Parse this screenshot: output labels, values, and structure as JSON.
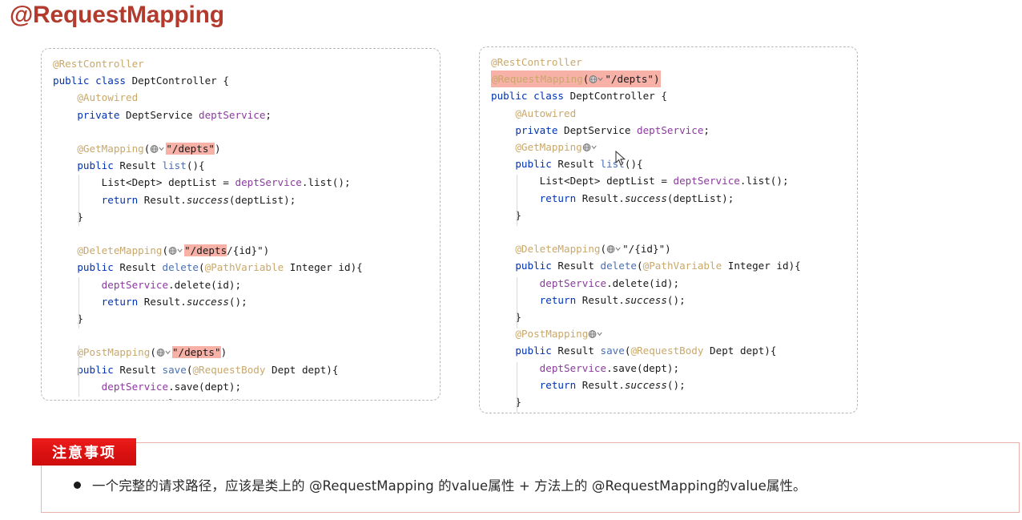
{
  "title": "@RequestMapping",
  "colors": {
    "title": "#b23b2e",
    "highlight": "#f7b1a7",
    "keyword": "#0033b3",
    "annotation": "#c9a86a",
    "field": "#8b3b9e",
    "method": "#4a6fb5",
    "badge_red": "#ee1c1c",
    "notes_border": "#e8b4ad"
  },
  "left_panel": {
    "name": "code-without-class-level-mapping",
    "lines": [
      {
        "indent": 0,
        "tokens": [
          {
            "t": "@RestController",
            "c": "ann"
          }
        ]
      },
      {
        "indent": 0,
        "tokens": [
          {
            "t": "public",
            "c": "kw"
          },
          {
            "t": " "
          },
          {
            "t": "class",
            "c": "kw"
          },
          {
            "t": " DeptController {"
          }
        ]
      },
      {
        "indent": 1,
        "tokens": [
          {
            "t": "@Autowired",
            "c": "ann"
          }
        ]
      },
      {
        "indent": 1,
        "tokens": [
          {
            "t": "private",
            "c": "kw"
          },
          {
            "t": " DeptService "
          },
          {
            "t": "deptService",
            "c": "fld"
          },
          {
            "t": ";"
          }
        ]
      },
      {
        "indent": 1,
        "blank": true
      },
      {
        "indent": 1,
        "tokens": [
          {
            "t": "@GetMapping",
            "c": "ann"
          },
          {
            "t": "("
          },
          {
            "t": "",
            "c": "inlay"
          },
          {
            "t": "\"/depts\"",
            "c": "hl"
          },
          {
            "t": ")"
          }
        ]
      },
      {
        "indent": 1,
        "tokens": [
          {
            "t": "public",
            "c": "kw"
          },
          {
            "t": " Result "
          },
          {
            "t": "list",
            "c": "mth"
          },
          {
            "t": "(){"
          }
        ]
      },
      {
        "indent": 2,
        "tokens": [
          {
            "t": "List<Dept> deptList = "
          },
          {
            "t": "deptService",
            "c": "fld"
          },
          {
            "t": ".list();"
          }
        ]
      },
      {
        "indent": 2,
        "tokens": [
          {
            "t": "return",
            "c": "kw"
          },
          {
            "t": " Result."
          },
          {
            "t": "success",
            "c": "ital"
          },
          {
            "t": "(deptList);"
          }
        ]
      },
      {
        "indent": 1,
        "tokens": [
          {
            "t": "}"
          }
        ]
      },
      {
        "indent": 1,
        "blank": true
      },
      {
        "indent": 1,
        "tokens": [
          {
            "t": "@DeleteMapping",
            "c": "ann"
          },
          {
            "t": "("
          },
          {
            "t": "",
            "c": "inlay"
          },
          {
            "t": "\"/depts",
            "c": "hl"
          },
          {
            "t": "/{id}\""
          },
          {
            "t": ")"
          }
        ]
      },
      {
        "indent": 1,
        "tokens": [
          {
            "t": "public",
            "c": "kw"
          },
          {
            "t": " Result "
          },
          {
            "t": "delete",
            "c": "mth"
          },
          {
            "t": "("
          },
          {
            "t": "@PathVariable",
            "c": "ann"
          },
          {
            "t": " Integer id){"
          }
        ]
      },
      {
        "indent": 2,
        "tokens": [
          {
            "t": "deptService",
            "c": "fld"
          },
          {
            "t": ".delete(id);"
          }
        ]
      },
      {
        "indent": 2,
        "tokens": [
          {
            "t": "return",
            "c": "kw"
          },
          {
            "t": " Result."
          },
          {
            "t": "success",
            "c": "ital"
          },
          {
            "t": "();"
          }
        ]
      },
      {
        "indent": 1,
        "tokens": [
          {
            "t": "}"
          }
        ]
      },
      {
        "indent": 1,
        "blank": true
      },
      {
        "indent": 1,
        "tokens": [
          {
            "t": "@PostMapping",
            "c": "ann"
          },
          {
            "t": "("
          },
          {
            "t": "",
            "c": "inlay"
          },
          {
            "t": "\"/depts\"",
            "c": "hl"
          },
          {
            "t": ")"
          }
        ]
      },
      {
        "indent": 1,
        "tokens": [
          {
            "t": "public",
            "c": "kw"
          },
          {
            "t": " Result "
          },
          {
            "t": "save",
            "c": "mth"
          },
          {
            "t": "("
          },
          {
            "t": "@RequestBody",
            "c": "ann"
          },
          {
            "t": " Dept dept){"
          }
        ]
      },
      {
        "indent": 2,
        "tokens": [
          {
            "t": "deptService",
            "c": "fld"
          },
          {
            "t": ".save(dept);"
          }
        ]
      },
      {
        "indent": 2,
        "tokens": [
          {
            "t": "return",
            "c": "kw"
          },
          {
            "t": " Result."
          },
          {
            "t": "success",
            "c": "ital"
          },
          {
            "t": "();"
          }
        ]
      },
      {
        "indent": 1,
        "tokens": [
          {
            "t": "}"
          }
        ]
      },
      {
        "indent": 1,
        "blank": true
      },
      {
        "indent": 0,
        "tokens": [
          {
            "t": "}"
          }
        ]
      }
    ]
  },
  "right_panel": {
    "name": "code-with-class-level-mapping",
    "lines": [
      {
        "indent": 0,
        "tokens": [
          {
            "t": "@RestController",
            "c": "ann"
          }
        ]
      },
      {
        "indent": 0,
        "hl_line": true,
        "tokens": [
          {
            "t": "@RequestMapping",
            "c": "ann"
          },
          {
            "t": "("
          },
          {
            "t": "",
            "c": "inlay"
          },
          {
            "t": "\"/depts\""
          },
          {
            "t": ")"
          }
        ]
      },
      {
        "indent": 0,
        "tokens": [
          {
            "t": "public",
            "c": "kw"
          },
          {
            "t": " "
          },
          {
            "t": "class",
            "c": "kw"
          },
          {
            "t": " DeptController {"
          }
        ]
      },
      {
        "indent": 1,
        "tokens": [
          {
            "t": "@Autowired",
            "c": "ann"
          }
        ]
      },
      {
        "indent": 1,
        "tokens": [
          {
            "t": "private",
            "c": "kw"
          },
          {
            "t": " DeptService "
          },
          {
            "t": "deptService",
            "c": "fld"
          },
          {
            "t": ";"
          }
        ]
      },
      {
        "indent": 1,
        "tokens": [
          {
            "t": "@GetMapping",
            "c": "ann"
          },
          {
            "t": "",
            "c": "inlay"
          }
        ]
      },
      {
        "indent": 1,
        "tokens": [
          {
            "t": "public",
            "c": "kw"
          },
          {
            "t": " Result "
          },
          {
            "t": "list",
            "c": "mth"
          },
          {
            "t": "(){"
          }
        ]
      },
      {
        "indent": 2,
        "tokens": [
          {
            "t": "List<Dept> deptList = "
          },
          {
            "t": "deptService",
            "c": "fld"
          },
          {
            "t": ".list();"
          }
        ]
      },
      {
        "indent": 2,
        "tokens": [
          {
            "t": "return",
            "c": "kw"
          },
          {
            "t": " Result."
          },
          {
            "t": "success",
            "c": "ital"
          },
          {
            "t": "(deptList);"
          }
        ]
      },
      {
        "indent": 1,
        "tokens": [
          {
            "t": "}"
          }
        ]
      },
      {
        "indent": 1,
        "blank": true
      },
      {
        "indent": 1,
        "tokens": [
          {
            "t": "@DeleteMapping",
            "c": "ann"
          },
          {
            "t": "("
          },
          {
            "t": "",
            "c": "inlay"
          },
          {
            "t": "\"/{id}\""
          },
          {
            "t": ")"
          }
        ]
      },
      {
        "indent": 1,
        "tokens": [
          {
            "t": "public",
            "c": "kw"
          },
          {
            "t": " Result "
          },
          {
            "t": "delete",
            "c": "mth"
          },
          {
            "t": "("
          },
          {
            "t": "@PathVariable",
            "c": "ann"
          },
          {
            "t": " Integer id){"
          }
        ]
      },
      {
        "indent": 2,
        "tokens": [
          {
            "t": "deptService",
            "c": "fld"
          },
          {
            "t": ".delete(id);"
          }
        ]
      },
      {
        "indent": 2,
        "tokens": [
          {
            "t": "return",
            "c": "kw"
          },
          {
            "t": " Result."
          },
          {
            "t": "success",
            "c": "ital"
          },
          {
            "t": "();"
          }
        ]
      },
      {
        "indent": 1,
        "tokens": [
          {
            "t": "}"
          }
        ]
      },
      {
        "indent": 1,
        "tokens": [
          {
            "t": "@PostMapping",
            "c": "ann"
          },
          {
            "t": "",
            "c": "inlay"
          }
        ]
      },
      {
        "indent": 1,
        "tokens": [
          {
            "t": "public",
            "c": "kw"
          },
          {
            "t": " Result "
          },
          {
            "t": "save",
            "c": "mth"
          },
          {
            "t": "("
          },
          {
            "t": "@RequestBody",
            "c": "ann"
          },
          {
            "t": " Dept dept){"
          }
        ]
      },
      {
        "indent": 2,
        "tokens": [
          {
            "t": "deptService",
            "c": "fld"
          },
          {
            "t": ".save(dept);"
          }
        ]
      },
      {
        "indent": 2,
        "tokens": [
          {
            "t": "return",
            "c": "kw"
          },
          {
            "t": " Result."
          },
          {
            "t": "success",
            "c": "ital"
          },
          {
            "t": "();"
          }
        ]
      },
      {
        "indent": 1,
        "tokens": [
          {
            "t": "}"
          }
        ]
      },
      {
        "indent": 1,
        "blank": true
      },
      {
        "indent": 0,
        "tokens": [
          {
            "t": "}"
          }
        ]
      }
    ]
  },
  "notes": {
    "badge_label": "注意事项",
    "bullets": [
      "一个完整的请求路径，应该是类上的 @RequestMapping 的value属性 + 方法上的 @RequestMapping的value属性。"
    ]
  }
}
